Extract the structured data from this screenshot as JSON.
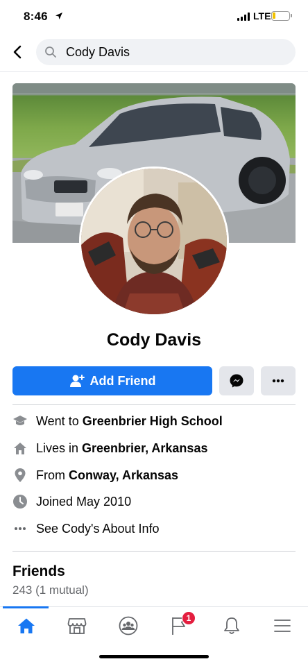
{
  "status_bar": {
    "time": "8:46",
    "network": "LTE"
  },
  "search": {
    "value": "Cody Davis",
    "icon": "search-icon"
  },
  "profile": {
    "name": "Cody Davis"
  },
  "actions": {
    "add_friend_label": "Add Friend"
  },
  "info": [
    {
      "icon": "graduation-cap-icon",
      "prefix": "Went to",
      "value": "Greenbrier High School"
    },
    {
      "icon": "home-icon",
      "prefix": "Lives in",
      "value": "Greenbrier, Arkansas"
    },
    {
      "icon": "location-pin-icon",
      "prefix": "From",
      "value": "Conway, Arkansas"
    },
    {
      "icon": "clock-icon",
      "prefix": "Joined May 2010",
      "value": ""
    },
    {
      "icon": "ellipsis-icon",
      "prefix": "See Cody's About Info",
      "value": ""
    }
  ],
  "friends": {
    "title": "Friends",
    "count_text": "243 (1 mutual)"
  },
  "bottom_nav": {
    "items": [
      "home-icon",
      "marketplace-icon",
      "groups-icon",
      "pages-flag-icon",
      "notifications-bell-icon",
      "menu-icon"
    ],
    "pages_badge": "1"
  },
  "colors": {
    "accent": "#1877f2",
    "button_grey": "#e4e6eb",
    "badge": "#e41e3f"
  }
}
